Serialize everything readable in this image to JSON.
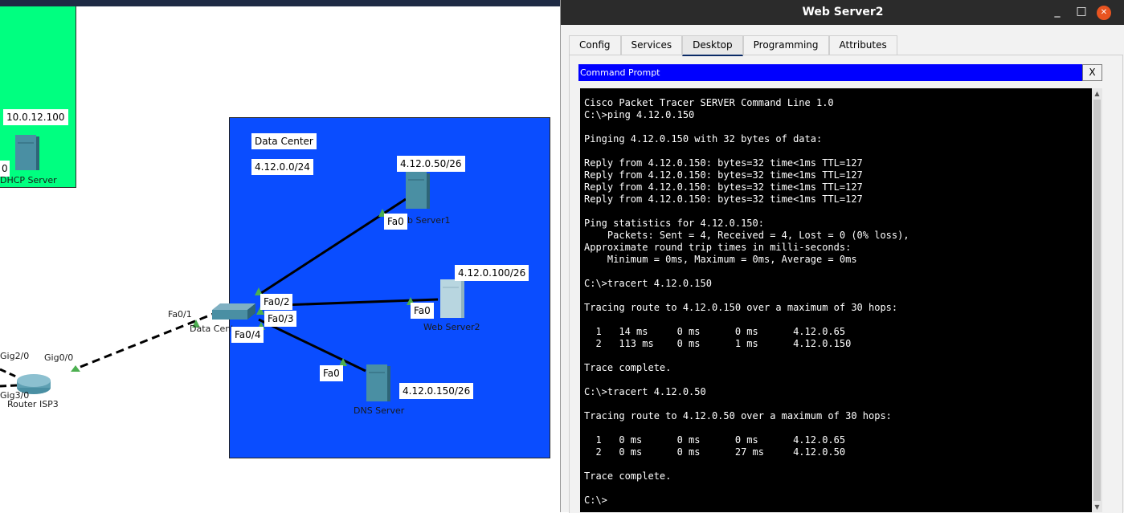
{
  "workspace": {
    "labels": {
      "dhcp_ip": "10.0.12.100",
      "dhcp_port": "0",
      "dhcp_name": "DHCP Server",
      "dc_title": "Data Center",
      "dc_network": "4.12.0.0/24",
      "ws1_ip": "4.12.0.50/26",
      "ws1_port": "Fa0",
      "ws1_name": "Web Server1",
      "ws2_ip": "4.12.0.100/26",
      "ws2_port": "Fa0",
      "ws2_name": "Web Server2",
      "dns_ip": "4.12.0.150/26",
      "dns_port": "Fa0",
      "dns_name": "DNS Server",
      "sw_fa02": "Fa0/2",
      "sw_fa03": "Fa0/3",
      "sw_fa04": "Fa0/4",
      "sw_fa01": "Fa0/1",
      "sw_name": "Data Center",
      "rt_gig20": "Gig2/0",
      "rt_gig00": "Gig0/0",
      "rt_gig30": "Gig3/0",
      "rt_name": "Router ISP3"
    },
    "colors": {
      "green_zone": "#00ff80",
      "datacenter_zone": "#0a4dff",
      "link_up": "#4caf50"
    }
  },
  "window": {
    "title": "Web Server2",
    "controls": {
      "minimize": "_",
      "maximize": "□",
      "close": "✕"
    },
    "tabs": [
      {
        "label": "Config",
        "active": false
      },
      {
        "label": "Services",
        "active": false
      },
      {
        "label": "Desktop",
        "active": true
      },
      {
        "label": "Programming",
        "active": false
      },
      {
        "label": "Attributes",
        "active": false
      }
    ],
    "command_prompt": {
      "title": "Command Prompt",
      "close_label": "X",
      "output": "Cisco Packet Tracer SERVER Command Line 1.0\nC:\\>ping 4.12.0.150\n\nPinging 4.12.0.150 with 32 bytes of data:\n\nReply from 4.12.0.150: bytes=32 time<1ms TTL=127\nReply from 4.12.0.150: bytes=32 time<1ms TTL=127\nReply from 4.12.0.150: bytes=32 time<1ms TTL=127\nReply from 4.12.0.150: bytes=32 time<1ms TTL=127\n\nPing statistics for 4.12.0.150:\n    Packets: Sent = 4, Received = 4, Lost = 0 (0% loss),\nApproximate round trip times in milli-seconds:\n    Minimum = 0ms, Maximum = 0ms, Average = 0ms\n\nC:\\>tracert 4.12.0.150\n\nTracing route to 4.12.0.150 over a maximum of 30 hops:\n\n  1   14 ms     0 ms      0 ms      4.12.0.65\n  2   113 ms    0 ms      1 ms      4.12.0.150\n\nTrace complete.\n\nC:\\>tracert 4.12.0.50\n\nTracing route to 4.12.0.50 over a maximum of 30 hops:\n\n  1   0 ms      0 ms      0 ms      4.12.0.65\n  2   0 ms      0 ms      27 ms     4.12.0.50\n\nTrace complete.\n\nC:\\>",
      "colors": {
        "title_bar": "#0000ff",
        "background": "#000000",
        "text": "#ffffff"
      }
    },
    "scrollbar": {
      "up": "▲",
      "down": "▼"
    }
  }
}
